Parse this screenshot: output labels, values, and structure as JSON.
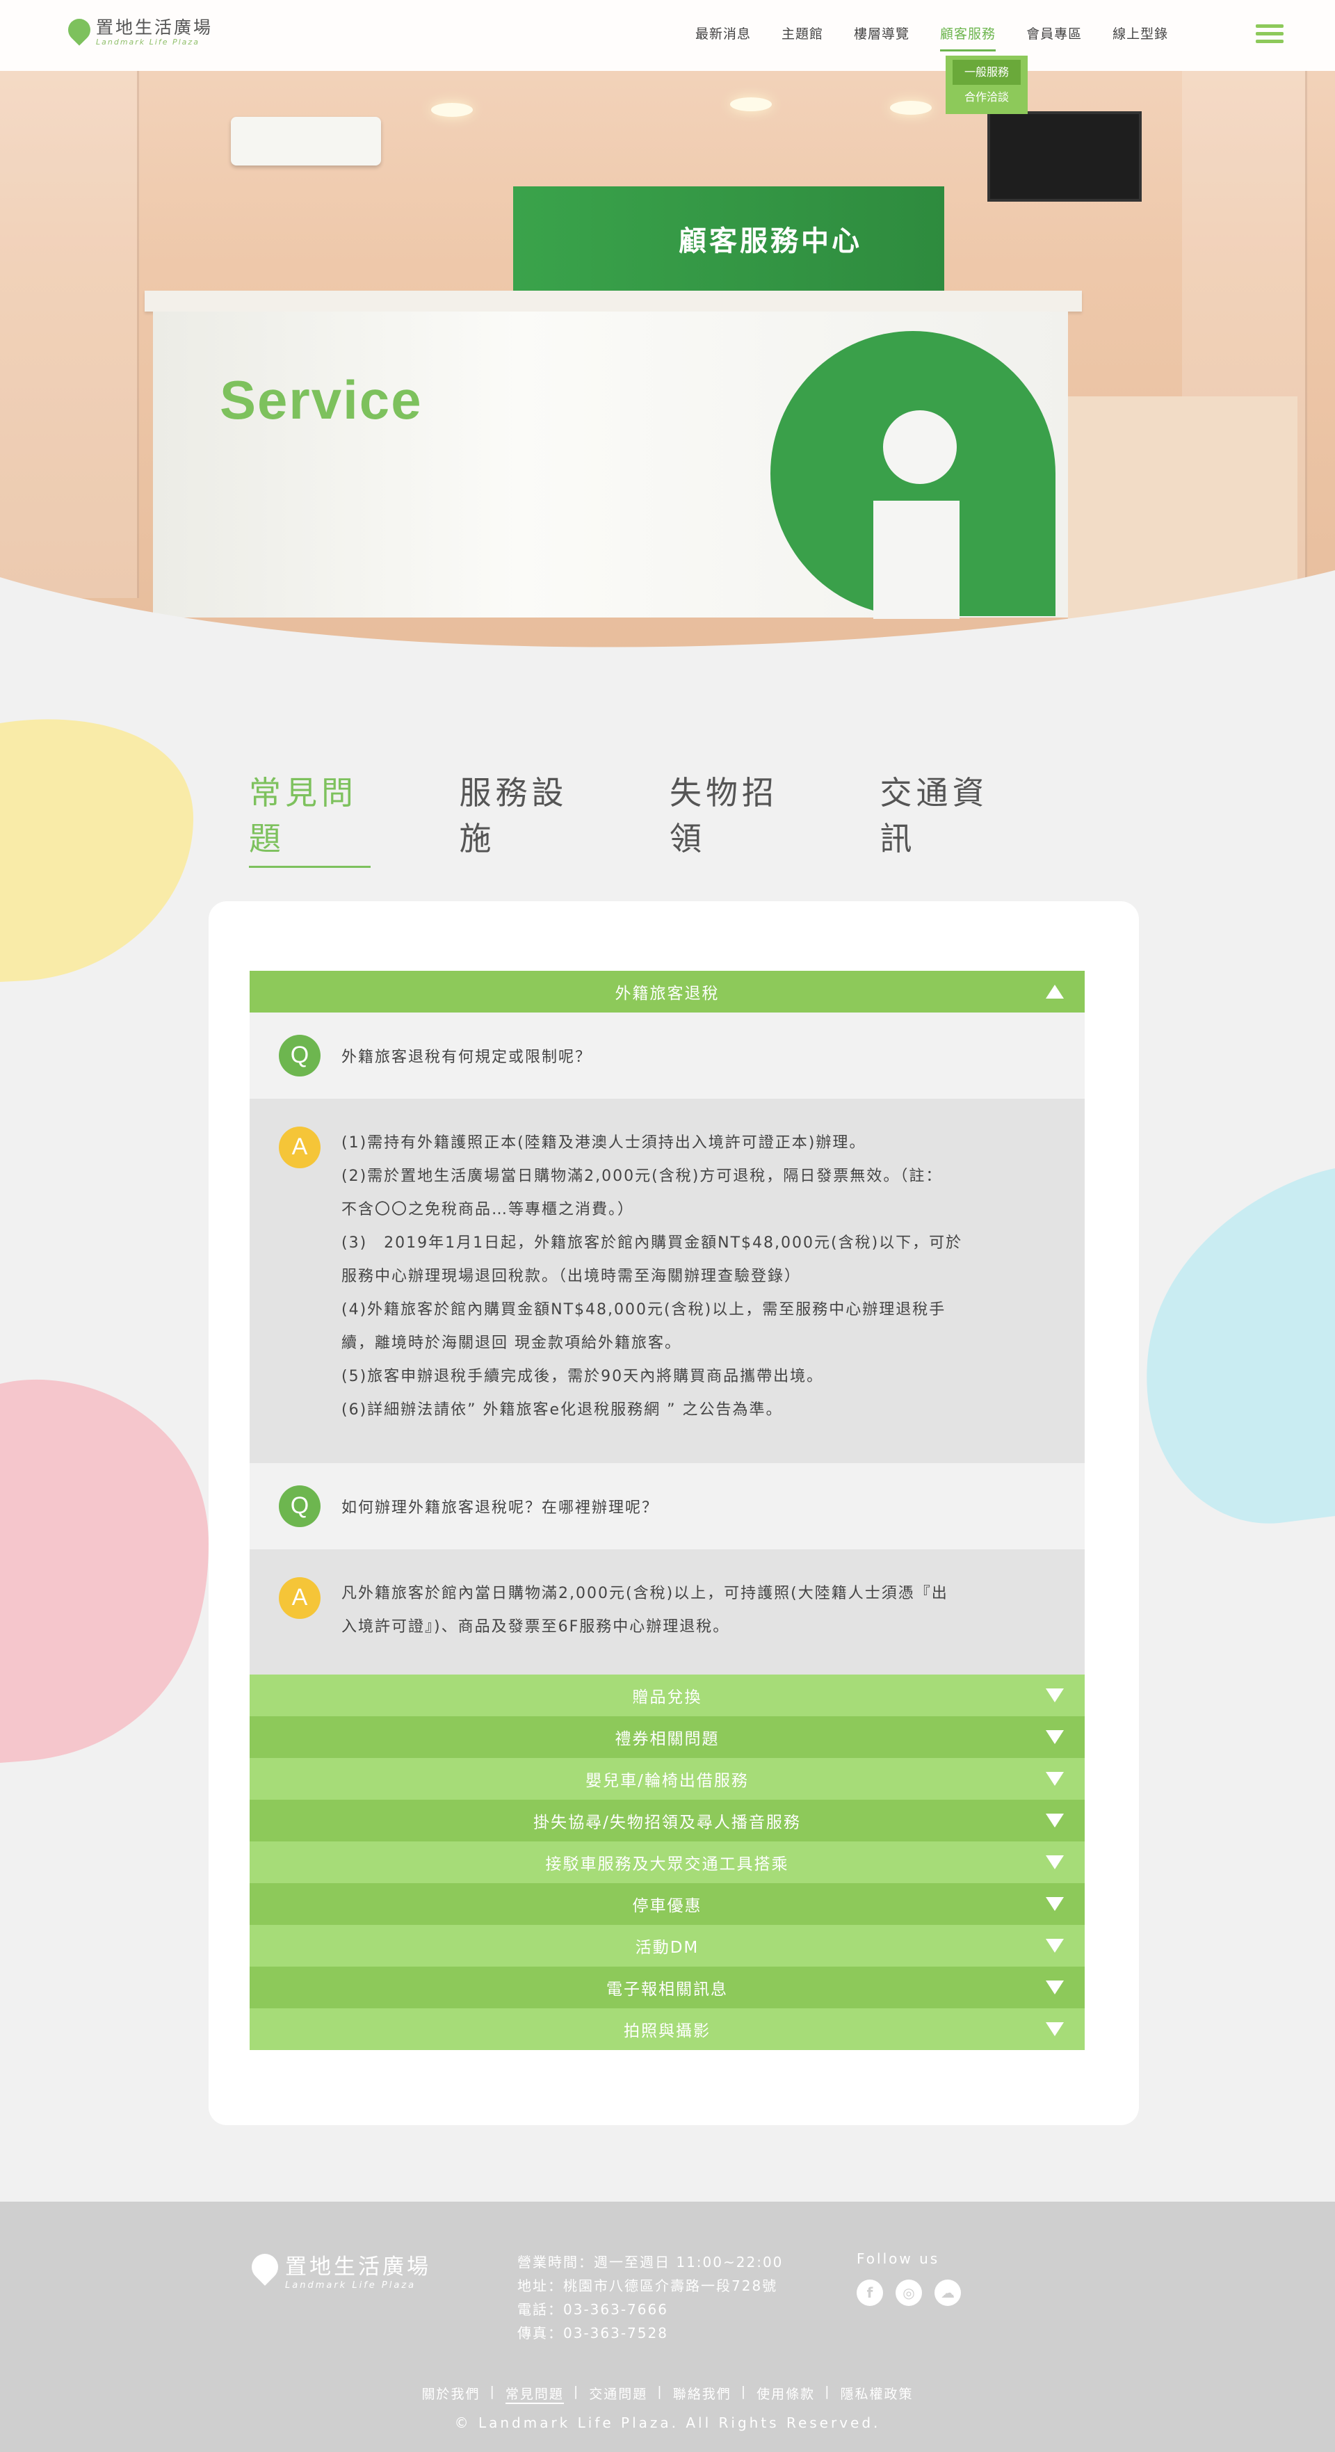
{
  "brand": {
    "name_cn": "置地生活廣場",
    "name_en": "Landmark Life Plaza"
  },
  "nav": {
    "items": [
      "最新消息",
      "主題館",
      "樓層導覽",
      "顧客服務",
      "會員專區",
      "線上型錄"
    ],
    "active": "顧客服務",
    "dropdown": [
      "一般服務",
      "合作洽談"
    ]
  },
  "hero": {
    "sign_text": "顧客服務中心",
    "wall_word": "Service"
  },
  "tabs": [
    "常見問題",
    "服務設施",
    "失物招領",
    "交通資訊"
  ],
  "faq": {
    "open_section": "外籍旅客退稅",
    "q1": "外籍旅客退稅有何規定或限制呢？",
    "a1": [
      "(1)需持有外籍護照正本(陸籍及港澳人士須持出入境許可證正本)辦理。",
      "(2)需於置地生活廣場當日購物滿2,000元(含稅)方可退稅，隔日發票無效。（註：",
      "不含〇〇之免稅商品…等專櫃之消費。）",
      "(3)　2019年1月1日起，外籍旅客於館內購買金額NT$48,000元(含稅)以下，可於",
      "服務中心辦理現場退回稅款。（出境時需至海關辦理查驗登錄）",
      "(4)外籍旅客於館內購買金額NT$48,000元(含稅)以上，需至服務中心辦理退稅手",
      "續，離境時於海關退回 現金款項給外籍旅客。",
      "(5)旅客申辦退稅手續完成後，需於90天內將購買商品攜帶出境。",
      "(6)詳細辦法請依” 外籍旅客e化退稅服務網 ” 之公告為準。"
    ],
    "q2": "如何辦理外籍旅客退稅呢？在哪裡辦理呢？",
    "a2": [
      "凡外籍旅客於館內當日購物滿2,000元(含稅)以上，可持護照(大陸籍人士須憑『出",
      "入境許可證』)、商品及發票至6F服務中心辦理退稅。"
    ],
    "badge_q": "Q",
    "badge_a": "A",
    "collapsed_sections": [
      "贈品兌換",
      "禮券相關問題",
      "嬰兒車/輪椅出借服務",
      "掛失協尋/失物招領及尋人播音服務",
      "接駁車服務及大眾交通工具搭乘",
      "停車優惠",
      "活動DM",
      "電子報相關訊息",
      "拍照與攝影"
    ]
  },
  "footer": {
    "hours": "營業時間：週一至週日 11:00~22:00",
    "address": "地址：桃園市八德區介壽路一段728號",
    "phone": "電話：03-363-7666",
    "fax": "傳真：03-363-7528",
    "follow": "Follow us",
    "social_icons": [
      "facebook-icon",
      "instagram-icon",
      "line-icon"
    ],
    "links": [
      "關於我們",
      "常見問題",
      "交通問題",
      "聯絡我們",
      "使用條款",
      "隱私權政策"
    ],
    "current_link": "常見問題",
    "copyright": "© Landmark Life Plaza. All Rights Reserved."
  },
  "colors": {
    "accent": "#7dc15d",
    "accent_dark": "#6db64f",
    "yellow": "#f5c538",
    "footer_bg": "#cfcfcf"
  }
}
